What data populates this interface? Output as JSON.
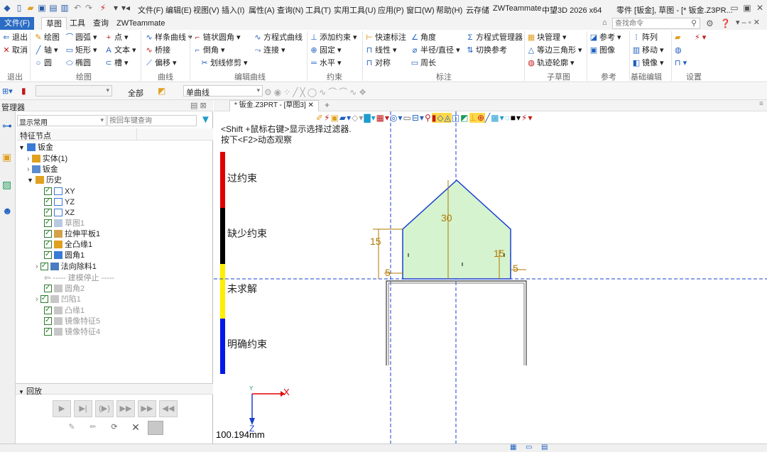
{
  "title": {
    "menu": [
      "文件(F)",
      "编辑(E)",
      "视图(V)",
      "插入(I)",
      "属性(A)",
      "查询(N)",
      "工具(T)",
      "实用工具(U)",
      "应用(P)",
      "窗口(W)",
      "帮助(H)",
      "云存储",
      "ZWTeammate"
    ],
    "app_title": "中望3D 2026 x64",
    "doc_info": "零件 [钣金], 草图 - [* 钣金.Z3PR..."
  },
  "tabs": {
    "file": "文件(F)",
    "items": [
      "草图",
      "工具",
      "查询",
      "ZWTeammate"
    ]
  },
  "search": {
    "placeholder": "查找命令"
  },
  "ribbon": {
    "col1": [
      "退出",
      "取消"
    ],
    "draw": [
      "绘图",
      "轴",
      "圆",
      "圆弧",
      "矩形",
      "椭圆",
      "点",
      "文本",
      "槽"
    ],
    "curve": [
      "样条曲线",
      "桥接",
      "偏移"
    ],
    "editcurve": [
      "链状圆角",
      "倒角",
      "划线修剪",
      "方程式曲线",
      "连接"
    ],
    "constraint": [
      "添加约束",
      "固定",
      "水平"
    ],
    "annot": [
      "快速标注",
      "线性",
      "对称",
      "角度",
      "半径/直径",
      "周长"
    ],
    "eq": [
      "方程式管理器",
      "切换参考"
    ],
    "sub": [
      "块管理",
      "等边三角形",
      "轨迹轮廓"
    ],
    "ref": [
      "参考",
      "图像"
    ],
    "basic": [
      "阵列",
      "移动",
      "镜像"
    ],
    "groups": [
      "退出",
      "绘图",
      "曲线",
      "编辑曲线",
      "约束",
      "标注",
      "子草图",
      "参考",
      "基础编辑",
      "设置"
    ]
  },
  "toolbar2": {
    "all_label": "全部",
    "curve_select": "单曲线"
  },
  "manager": {
    "title": "管理器",
    "filter": "显示常用",
    "search_placeholder": "按回车键查询",
    "header": "特征节点",
    "root": "钣金",
    "items": [
      {
        "label": "实体(1)"
      },
      {
        "label": "钣金"
      },
      {
        "label": "历史"
      },
      {
        "label": "XY"
      },
      {
        "label": "YZ"
      },
      {
        "label": "XZ"
      },
      {
        "label": "草图1"
      },
      {
        "label": "拉伸平板1"
      },
      {
        "label": "全凸缘1"
      },
      {
        "label": "圆角1"
      },
      {
        "label": "法向除料1"
      },
      {
        "label": "----- 建模停止 -----"
      },
      {
        "label": "圆角2"
      },
      {
        "label": "凹陷1"
      },
      {
        "label": "凸缘1"
      },
      {
        "label": "镜像特征5"
      },
      {
        "label": "镜像特征4"
      }
    ],
    "playback": "回放"
  },
  "doc_tab": "* 钣金.Z3PRT - [草图3]",
  "hints": [
    "<Shift +鼠标右键>显示选择过滤器.",
    "按下<F2>动态观察"
  ],
  "legend": [
    {
      "label": "过约束",
      "color": "#e00000"
    },
    {
      "label": "缺少约束",
      "color": "#000000"
    },
    {
      "label": "未求解",
      "color": "#ffee00"
    },
    {
      "label": "明确约束",
      "color": "#0018e8"
    }
  ],
  "sketch": {
    "dim_height": "30",
    "dim_left": "15",
    "dim_right": "15",
    "dim_5_left": "5",
    "dim_5_right": "5"
  },
  "axis": {
    "x": "X",
    "y": "Y",
    "z": "Z"
  },
  "scale_text": "100.194mm"
}
